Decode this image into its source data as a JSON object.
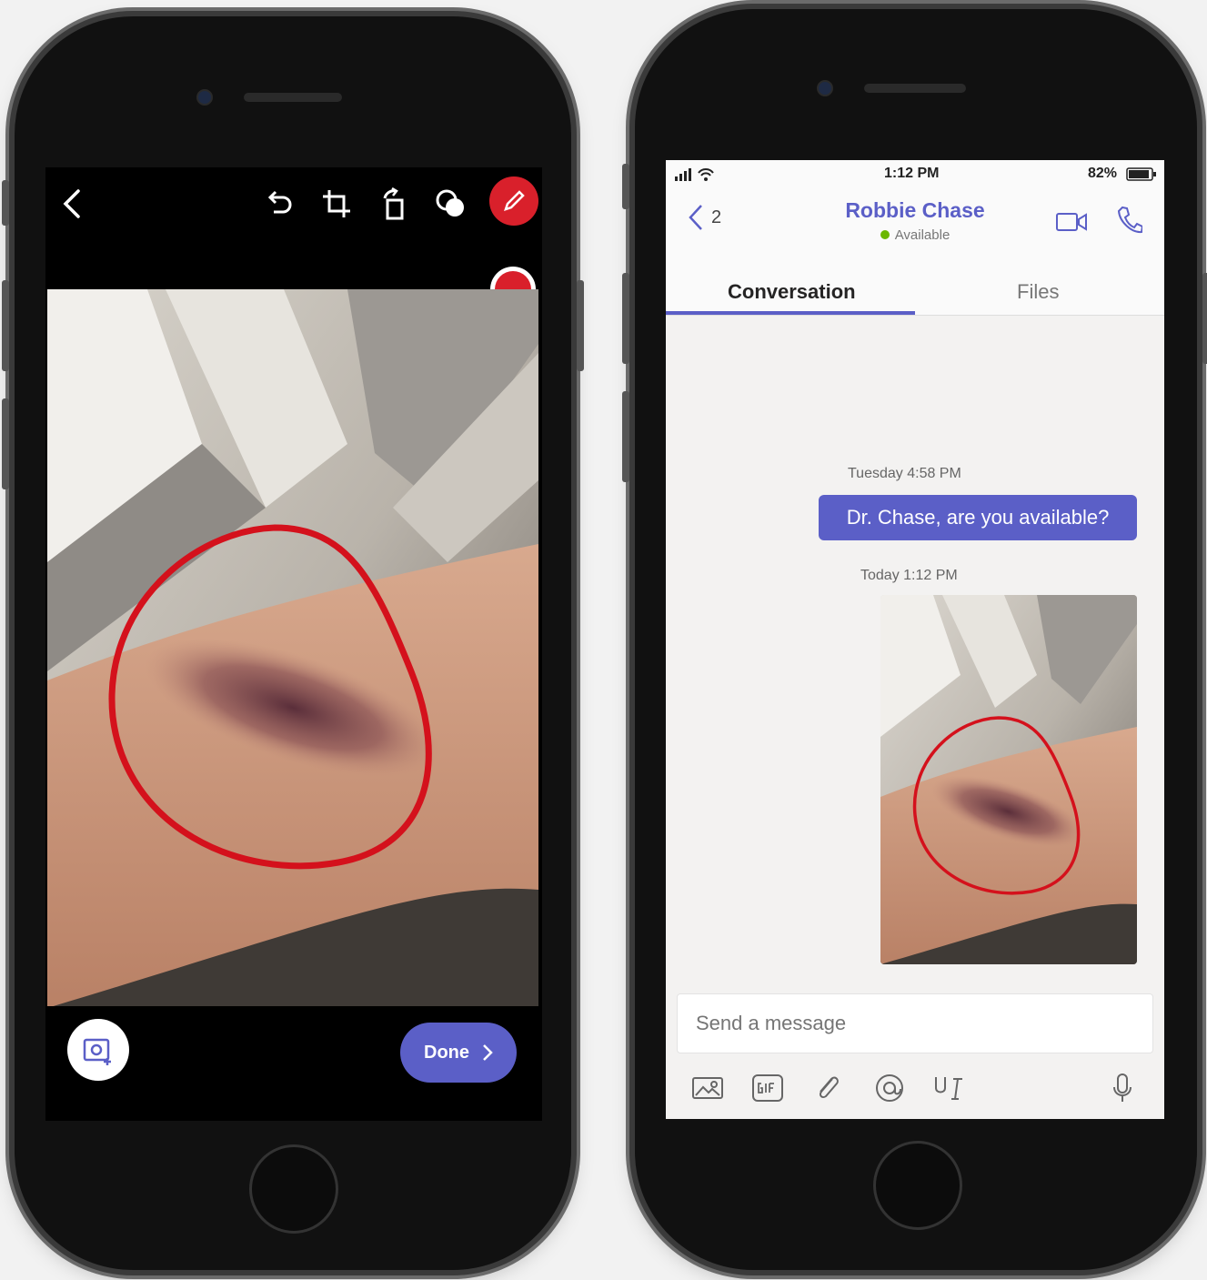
{
  "editor": {
    "toolbar": {
      "back_icon": "chevron-left-icon",
      "undo_icon": "undo-icon",
      "crop_icon": "crop-icon",
      "rotate_icon": "rotate-icon",
      "filter_icon": "filter-icon",
      "pen_icon": "pen-icon"
    },
    "colors": [
      {
        "name": "red",
        "hex": "#d9202b",
        "selected": true
      },
      {
        "name": "green",
        "hex": "#22a83a"
      },
      {
        "name": "blue",
        "hex": "#1f63f0"
      },
      {
        "name": "yellow",
        "hex": "#f7e200"
      },
      {
        "name": "white",
        "hex": "#ffffff"
      },
      {
        "name": "black",
        "hex": "#000000"
      }
    ],
    "done_label": "Done"
  },
  "chat": {
    "status": {
      "time": "1:12 PM",
      "battery": "82%"
    },
    "header": {
      "back_count": "2",
      "contact_name": "Robbie Chase",
      "presence": "Available"
    },
    "tabs": [
      "Conversation",
      "Files"
    ],
    "messages": {
      "time1": "Tuesday 4:58 PM",
      "bubble_text": "Dr. Chase, are you available?",
      "time2": "Today 1:12 PM"
    },
    "compose": {
      "placeholder": "Send a message"
    },
    "accent": "#5b5fc7"
  }
}
